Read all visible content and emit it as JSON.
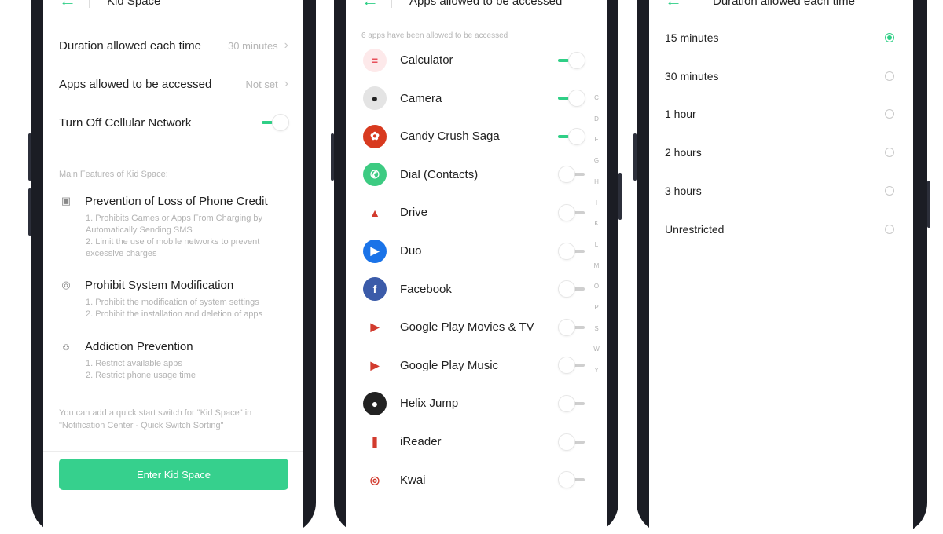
{
  "panel1": {
    "title": "Kid Space",
    "settings": [
      {
        "label": "Duration allowed each time",
        "value": "30 minutes"
      },
      {
        "label": "Apps allowed to be accessed",
        "value": "Not set"
      }
    ],
    "cellular": {
      "label": "Turn Off Cellular Network",
      "on": true
    },
    "features_heading": "Main Features of Kid Space:",
    "features": [
      {
        "title": "Prevention of Loss of Phone Credit",
        "icon": "credit-icon",
        "lines": [
          "1. Prohibits Games or Apps From Charging by Automatically Sending SMS",
          "2. Limit the use of mobile networks to prevent excessive charges"
        ]
      },
      {
        "title": "Prohibit System Modification",
        "icon": "settings-icon",
        "lines": [
          "1. Prohibit the modification of system settings",
          "2. Prohibit the installation and deletion of apps"
        ]
      },
      {
        "title": "Addiction Prevention",
        "icon": "face-icon",
        "lines": [
          "1. Restrict available apps",
          "2. Restrict phone usage time"
        ]
      }
    ],
    "note": "You can add a quick start switch for \"Kid Space\" in \"Notification Center - Quick Switch Sorting\"",
    "enter_label": "Enter Kid Space"
  },
  "panel2": {
    "title": "Apps allowed to be accessed",
    "subtitle": "6 apps have been allowed to be accessed",
    "apps": [
      {
        "name": "Calculator",
        "on": true,
        "icon": "calculator-icon",
        "color": "#fde9ea",
        "glyph": "="
      },
      {
        "name": "Camera",
        "on": true,
        "icon": "camera-icon",
        "color": "#e4e4e4",
        "glyph": "●"
      },
      {
        "name": "Candy Crush Saga",
        "on": true,
        "icon": "candy-crush-icon",
        "color": "#d83a1f",
        "glyph": "✿"
      },
      {
        "name": "Dial (Contacts)",
        "on": false,
        "icon": "phone-icon",
        "color": "#3dcb82",
        "glyph": "✆"
      },
      {
        "name": "Drive",
        "on": false,
        "icon": "drive-icon",
        "color": "#ffffff",
        "glyph": "▲"
      },
      {
        "name": "Duo",
        "on": false,
        "icon": "duo-icon",
        "color": "#1a73e8",
        "glyph": "▶"
      },
      {
        "name": "Facebook",
        "on": false,
        "icon": "facebook-icon",
        "color": "#3b5ba9",
        "glyph": "f"
      },
      {
        "name": "Google Play Movies & TV",
        "on": false,
        "icon": "play-movies-icon",
        "color": "#ffffff",
        "glyph": "▶"
      },
      {
        "name": "Google Play Music",
        "on": false,
        "icon": "play-music-icon",
        "color": "#ffffff",
        "glyph": "▶"
      },
      {
        "name": "Helix Jump",
        "on": false,
        "icon": "helix-jump-icon",
        "color": "#222222",
        "glyph": "●"
      },
      {
        "name": "iReader",
        "on": false,
        "icon": "ireader-icon",
        "color": "#ffffff",
        "glyph": "❚"
      },
      {
        "name": "Kwai",
        "on": false,
        "icon": "kwai-icon",
        "color": "#ffffff",
        "glyph": "◎"
      }
    ],
    "index_letters": [
      "C",
      "D",
      "F",
      "G",
      "H",
      "I",
      "K",
      "L",
      "M",
      "O",
      "P",
      "S",
      "W",
      "Y"
    ]
  },
  "panel3": {
    "title": "Duration allowed each time",
    "options": [
      {
        "label": "15 minutes",
        "selected": true
      },
      {
        "label": "30 minutes",
        "selected": false
      },
      {
        "label": "1 hour",
        "selected": false
      },
      {
        "label": "2 hours",
        "selected": false
      },
      {
        "label": "3 hours",
        "selected": false
      },
      {
        "label": "Unrestricted",
        "selected": false
      }
    ]
  },
  "colors": {
    "accent": "#2fcf86",
    "button": "#36d08d",
    "frame": "#1b1d24"
  }
}
